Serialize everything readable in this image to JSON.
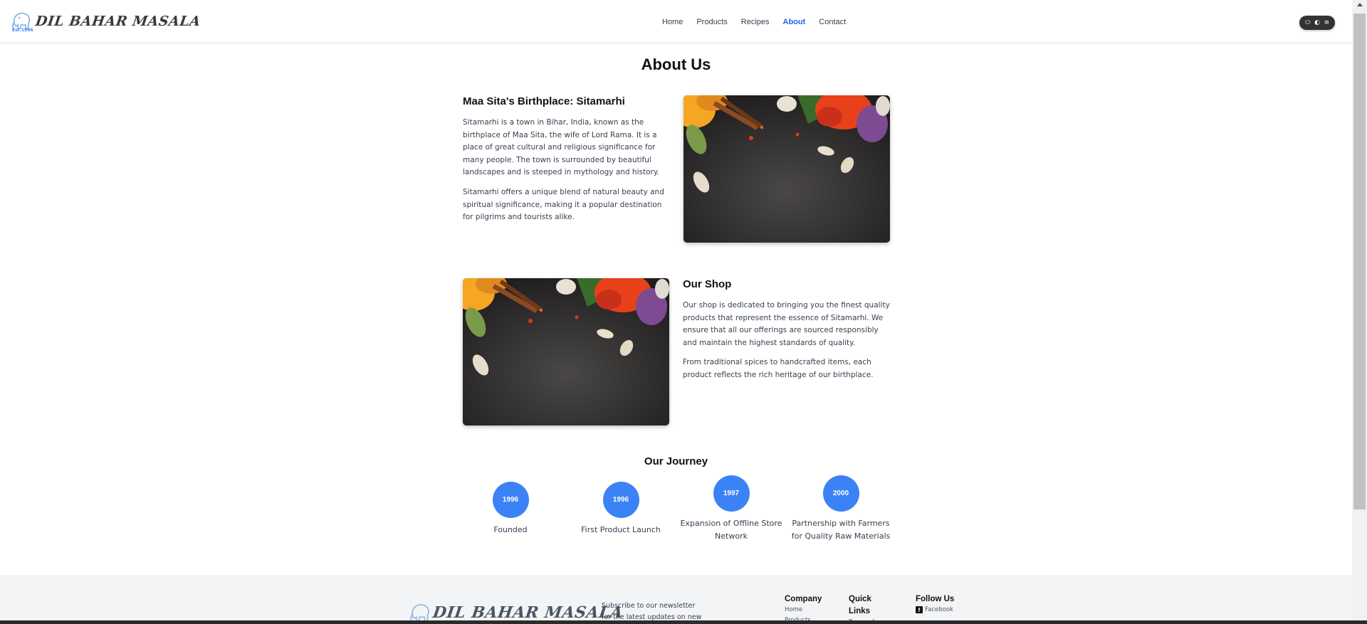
{
  "brand": {
    "name": "DIL BAHAR  MASALA",
    "est": "Est.1996"
  },
  "nav": {
    "items": [
      {
        "label": "Home",
        "active": false
      },
      {
        "label": "Products",
        "active": false
      },
      {
        "label": "Recipes",
        "active": false
      },
      {
        "label": "About",
        "active": true
      },
      {
        "label": "Contact",
        "active": false
      }
    ],
    "accent": "#2563eb"
  },
  "toolbar_pill": {
    "icons": [
      "chat-icon",
      "toggle-icon",
      "menu-icon"
    ],
    "glyphs": [
      "⬭",
      "◐",
      "≡"
    ]
  },
  "page": {
    "title": "About Us"
  },
  "birthplace": {
    "heading": "Maa Sita's Birthplace: Sitamarhi",
    "p1": "Sitamarhi is a town in Bihar, India, known as the birthplace of Maa Sita, the wife of Lord Rama. It is a place of great cultural and religious significance for many people. The town is surrounded by beautiful landscapes and is steeped in mythology and history.",
    "p2": "Sitamarhi offers a unique blend of natural beauty and spiritual significance, making it a popular destination for pilgrims and tourists alike.",
    "image_alt": "spices-image"
  },
  "shop": {
    "heading": "Our Shop",
    "p1": "Our shop is dedicated to bringing you the finest quality products that represent the essence of Sitamarhi. We ensure that all our offerings are sourced responsibly and maintain the highest standards of quality.",
    "p2": "From traditional spices to handcrafted items, each product reflects the rich heritage of our birthplace.",
    "image_alt": "spices-image"
  },
  "journey": {
    "title": "Our Journey",
    "milestones": [
      {
        "year": "1996",
        "label": "Founded"
      },
      {
        "year": "1996",
        "label": "First Product Launch"
      },
      {
        "year": "1997",
        "label": "Expansion of Offline Store Network"
      },
      {
        "year": "2000",
        "label": "Partnership with Farmers for Quality Raw Materials"
      }
    ],
    "circle_color": "#3b82f6"
  },
  "footer": {
    "newsletter": "Subscribe to our newsletter for the latest updates on new",
    "company": {
      "heading": "Company",
      "links": [
        "Home",
        "Products"
      ]
    },
    "quick_links": {
      "heading": "Quick Links",
      "links": [
        "Terms of"
      ]
    },
    "follow": {
      "heading": "Follow Us",
      "links": [
        "Facebook"
      ]
    }
  }
}
